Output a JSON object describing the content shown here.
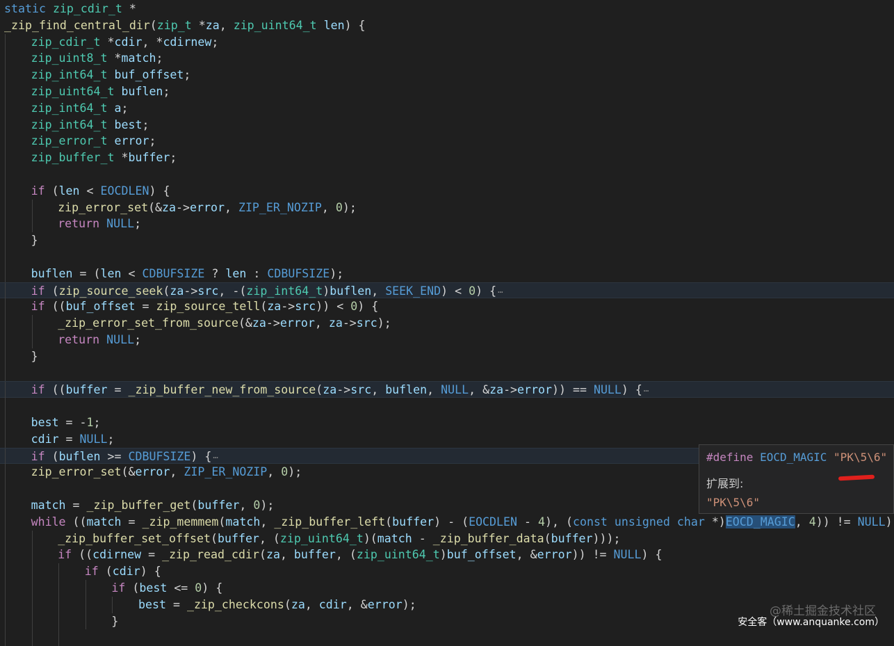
{
  "editor": {
    "language": "C",
    "lines": [
      {
        "indent": 0,
        "tokens": [
          [
            "kw",
            "static"
          ],
          [
            "op",
            " "
          ],
          [
            "ty",
            "zip_cdir_t"
          ],
          [
            "op",
            " *"
          ]
        ]
      },
      {
        "indent": 0,
        "tokens": [
          [
            "fn",
            "_zip_find_central_dir"
          ],
          [
            "op",
            "("
          ],
          [
            "ty",
            "zip_t"
          ],
          [
            "op",
            " *"
          ],
          [
            "var",
            "za"
          ],
          [
            "op",
            ", "
          ],
          [
            "ty",
            "zip_uint64_t"
          ],
          [
            "op",
            " "
          ],
          [
            "var",
            "len"
          ],
          [
            "op",
            ") {"
          ]
        ]
      },
      {
        "indent": 1,
        "tokens": [
          [
            "ty",
            "zip_cdir_t"
          ],
          [
            "op",
            " *"
          ],
          [
            "var",
            "cdir"
          ],
          [
            "op",
            ", *"
          ],
          [
            "var",
            "cdirnew"
          ],
          [
            "op",
            ";"
          ]
        ]
      },
      {
        "indent": 1,
        "tokens": [
          [
            "ty",
            "zip_uint8_t"
          ],
          [
            "op",
            " *"
          ],
          [
            "var",
            "match"
          ],
          [
            "op",
            ";"
          ]
        ]
      },
      {
        "indent": 1,
        "tokens": [
          [
            "ty",
            "zip_int64_t"
          ],
          [
            "op",
            " "
          ],
          [
            "var",
            "buf_offset"
          ],
          [
            "op",
            ";"
          ]
        ]
      },
      {
        "indent": 1,
        "tokens": [
          [
            "ty",
            "zip_uint64_t"
          ],
          [
            "op",
            " "
          ],
          [
            "var",
            "buflen"
          ],
          [
            "op",
            ";"
          ]
        ]
      },
      {
        "indent": 1,
        "tokens": [
          [
            "ty",
            "zip_int64_t"
          ],
          [
            "op",
            " "
          ],
          [
            "var",
            "a"
          ],
          [
            "op",
            ";"
          ]
        ]
      },
      {
        "indent": 1,
        "tokens": [
          [
            "ty",
            "zip_int64_t"
          ],
          [
            "op",
            " "
          ],
          [
            "var",
            "best"
          ],
          [
            "op",
            ";"
          ]
        ]
      },
      {
        "indent": 1,
        "tokens": [
          [
            "ty",
            "zip_error_t"
          ],
          [
            "op",
            " "
          ],
          [
            "var",
            "error"
          ],
          [
            "op",
            ";"
          ]
        ]
      },
      {
        "indent": 1,
        "tokens": [
          [
            "ty",
            "zip_buffer_t"
          ],
          [
            "op",
            " *"
          ],
          [
            "var",
            "buffer"
          ],
          [
            "op",
            ";"
          ]
        ]
      },
      {
        "indent": 1,
        "tokens": []
      },
      {
        "indent": 1,
        "tokens": [
          [
            "ctrl",
            "if"
          ],
          [
            "op",
            " ("
          ],
          [
            "var",
            "len"
          ],
          [
            "op",
            " < "
          ],
          [
            "mac",
            "EOCDLEN"
          ],
          [
            "op",
            ") {"
          ]
        ]
      },
      {
        "indent": 2,
        "tokens": [
          [
            "fn",
            "zip_error_set"
          ],
          [
            "op",
            "(&"
          ],
          [
            "var",
            "za"
          ],
          [
            "op",
            "->"
          ],
          [
            "var",
            "error"
          ],
          [
            "op",
            ", "
          ],
          [
            "mac",
            "ZIP_ER_NOZIP"
          ],
          [
            "op",
            ", "
          ],
          [
            "num",
            "0"
          ],
          [
            "op",
            ");"
          ]
        ]
      },
      {
        "indent": 2,
        "tokens": [
          [
            "ctrl",
            "return"
          ],
          [
            "op",
            " "
          ],
          [
            "mac",
            "NULL"
          ],
          [
            "op",
            ";"
          ]
        ]
      },
      {
        "indent": 1,
        "tokens": [
          [
            "op",
            "}"
          ]
        ]
      },
      {
        "indent": 1,
        "tokens": []
      },
      {
        "indent": 1,
        "tokens": [
          [
            "var",
            "buflen"
          ],
          [
            "op",
            " = ("
          ],
          [
            "var",
            "len"
          ],
          [
            "op",
            " < "
          ],
          [
            "mac",
            "CDBUFSIZE"
          ],
          [
            "op",
            " ? "
          ],
          [
            "var",
            "len"
          ],
          [
            "op",
            " : "
          ],
          [
            "mac",
            "CDBUFSIZE"
          ],
          [
            "op",
            ");"
          ]
        ]
      },
      {
        "indent": 1,
        "hl": true,
        "fold": true,
        "tokens": [
          [
            "ctrl",
            "if"
          ],
          [
            "op",
            " ("
          ],
          [
            "fn",
            "zip_source_seek"
          ],
          [
            "op",
            "("
          ],
          [
            "var",
            "za"
          ],
          [
            "op",
            "->"
          ],
          [
            "var",
            "src"
          ],
          [
            "op",
            ", -("
          ],
          [
            "ty",
            "zip_int64_t"
          ],
          [
            "op",
            ")"
          ],
          [
            "var",
            "buflen"
          ],
          [
            "op",
            ", "
          ],
          [
            "mac",
            "SEEK_END"
          ],
          [
            "op",
            ") < "
          ],
          [
            "num",
            "0"
          ],
          [
            "op",
            ") {"
          ]
        ]
      },
      {
        "indent": 1,
        "tokens": [
          [
            "ctrl",
            "if"
          ],
          [
            "op",
            " (("
          ],
          [
            "var",
            "buf_offset"
          ],
          [
            "op",
            " = "
          ],
          [
            "fn",
            "zip_source_tell"
          ],
          [
            "op",
            "("
          ],
          [
            "var",
            "za"
          ],
          [
            "op",
            "->"
          ],
          [
            "var",
            "src"
          ],
          [
            "op",
            ")) < "
          ],
          [
            "num",
            "0"
          ],
          [
            "op",
            ") {"
          ]
        ]
      },
      {
        "indent": 2,
        "tokens": [
          [
            "fn",
            "_zip_error_set_from_source"
          ],
          [
            "op",
            "(&"
          ],
          [
            "var",
            "za"
          ],
          [
            "op",
            "->"
          ],
          [
            "var",
            "error"
          ],
          [
            "op",
            ", "
          ],
          [
            "var",
            "za"
          ],
          [
            "op",
            "->"
          ],
          [
            "var",
            "src"
          ],
          [
            "op",
            ");"
          ]
        ]
      },
      {
        "indent": 2,
        "tokens": [
          [
            "ctrl",
            "return"
          ],
          [
            "op",
            " "
          ],
          [
            "mac",
            "NULL"
          ],
          [
            "op",
            ";"
          ]
        ]
      },
      {
        "indent": 1,
        "tokens": [
          [
            "op",
            "}"
          ]
        ]
      },
      {
        "indent": 1,
        "tokens": []
      },
      {
        "indent": 1,
        "hl": true,
        "fold": true,
        "tokens": [
          [
            "ctrl",
            "if"
          ],
          [
            "op",
            " (("
          ],
          [
            "var",
            "buffer"
          ],
          [
            "op",
            " = "
          ],
          [
            "fn",
            "_zip_buffer_new_from_source"
          ],
          [
            "op",
            "("
          ],
          [
            "var",
            "za"
          ],
          [
            "op",
            "->"
          ],
          [
            "var",
            "src"
          ],
          [
            "op",
            ", "
          ],
          [
            "var",
            "buflen"
          ],
          [
            "op",
            ", "
          ],
          [
            "mac",
            "NULL"
          ],
          [
            "op",
            ", &"
          ],
          [
            "var",
            "za"
          ],
          [
            "op",
            "->"
          ],
          [
            "var",
            "error"
          ],
          [
            "op",
            ")) == "
          ],
          [
            "mac",
            "NULL"
          ],
          [
            "op",
            ") {"
          ]
        ]
      },
      {
        "indent": 1,
        "tokens": []
      },
      {
        "indent": 1,
        "tokens": [
          [
            "var",
            "best"
          ],
          [
            "op",
            " = -"
          ],
          [
            "num",
            "1"
          ],
          [
            "op",
            ";"
          ]
        ]
      },
      {
        "indent": 1,
        "tokens": [
          [
            "var",
            "cdir"
          ],
          [
            "op",
            " = "
          ],
          [
            "mac",
            "NULL"
          ],
          [
            "op",
            ";"
          ]
        ]
      },
      {
        "indent": 1,
        "hl": true,
        "fold": true,
        "tokens": [
          [
            "ctrl",
            "if"
          ],
          [
            "op",
            " ("
          ],
          [
            "var",
            "buflen"
          ],
          [
            "op",
            " >= "
          ],
          [
            "mac",
            "CDBUFSIZE"
          ],
          [
            "op",
            ") {"
          ]
        ]
      },
      {
        "indent": 1,
        "tokens": [
          [
            "fn",
            "zip_error_set"
          ],
          [
            "op",
            "(&"
          ],
          [
            "var",
            "error"
          ],
          [
            "op",
            ", "
          ],
          [
            "mac",
            "ZIP_ER_NOZIP"
          ],
          [
            "op",
            ", "
          ],
          [
            "num",
            "0"
          ],
          [
            "op",
            ");"
          ]
        ]
      },
      {
        "indent": 1,
        "tokens": []
      },
      {
        "indent": 1,
        "tokens": [
          [
            "var",
            "match"
          ],
          [
            "op",
            " = "
          ],
          [
            "fn",
            "_zip_buffer_get"
          ],
          [
            "op",
            "("
          ],
          [
            "var",
            "buffer"
          ],
          [
            "op",
            ", "
          ],
          [
            "num",
            "0"
          ],
          [
            "op",
            ");"
          ]
        ]
      },
      {
        "indent": 1,
        "tokens": [
          [
            "ctrl",
            "while"
          ],
          [
            "op",
            " (("
          ],
          [
            "var",
            "match"
          ],
          [
            "op",
            " = "
          ],
          [
            "fn",
            "_zip_memmem"
          ],
          [
            "op",
            "("
          ],
          [
            "var",
            "match"
          ],
          [
            "op",
            ", "
          ],
          [
            "fn",
            "_zip_buffer_left"
          ],
          [
            "op",
            "("
          ],
          [
            "var",
            "buffer"
          ],
          [
            "op",
            ") - ("
          ],
          [
            "mac",
            "EOCDLEN"
          ],
          [
            "op",
            " - "
          ],
          [
            "num",
            "4"
          ],
          [
            "op",
            "), ("
          ],
          [
            "kw",
            "const"
          ],
          [
            "op",
            " "
          ],
          [
            "kw",
            "unsigned"
          ],
          [
            "op",
            " "
          ],
          [
            "kw",
            "char"
          ],
          [
            "op",
            " *)"
          ],
          [
            "hov",
            "EOCD_MAGIC"
          ],
          [
            "op",
            ", "
          ],
          [
            "num",
            "4"
          ],
          [
            "op",
            ")) != "
          ],
          [
            "mac",
            "NULL"
          ],
          [
            "op",
            ") {"
          ]
        ]
      },
      {
        "indent": 2,
        "tokens": [
          [
            "fn",
            "_zip_buffer_set_offset"
          ],
          [
            "op",
            "("
          ],
          [
            "var",
            "buffer"
          ],
          [
            "op",
            ", ("
          ],
          [
            "ty",
            "zip_uint64_t"
          ],
          [
            "op",
            ")("
          ],
          [
            "var",
            "match"
          ],
          [
            "op",
            " - "
          ],
          [
            "fn",
            "_zip_buffer_data"
          ],
          [
            "op",
            "("
          ],
          [
            "var",
            "buffer"
          ],
          [
            "op",
            ")));"
          ]
        ]
      },
      {
        "indent": 2,
        "tokens": [
          [
            "ctrl",
            "if"
          ],
          [
            "op",
            " (("
          ],
          [
            "var",
            "cdirnew"
          ],
          [
            "op",
            " = "
          ],
          [
            "fn",
            "_zip_read_cdir"
          ],
          [
            "op",
            "("
          ],
          [
            "var",
            "za"
          ],
          [
            "op",
            ", "
          ],
          [
            "var",
            "buffer"
          ],
          [
            "op",
            ", ("
          ],
          [
            "ty",
            "zip_uint64_t"
          ],
          [
            "op",
            ")"
          ],
          [
            "var",
            "buf_offset"
          ],
          [
            "op",
            ", &"
          ],
          [
            "var",
            "error"
          ],
          [
            "op",
            ")) != "
          ],
          [
            "mac",
            "NULL"
          ],
          [
            "op",
            ") {"
          ]
        ]
      },
      {
        "indent": 3,
        "tokens": [
          [
            "ctrl",
            "if"
          ],
          [
            "op",
            " ("
          ],
          [
            "var",
            "cdir"
          ],
          [
            "op",
            ") {"
          ]
        ]
      },
      {
        "indent": 4,
        "tokens": [
          [
            "ctrl",
            "if"
          ],
          [
            "op",
            " ("
          ],
          [
            "var",
            "best"
          ],
          [
            "op",
            " <= "
          ],
          [
            "num",
            "0"
          ],
          [
            "op",
            ") {"
          ]
        ]
      },
      {
        "indent": 5,
        "tokens": [
          [
            "var",
            "best"
          ],
          [
            "op",
            " = "
          ],
          [
            "fn",
            "_zip_checkcons"
          ],
          [
            "op",
            "("
          ],
          [
            "var",
            "za"
          ],
          [
            "op",
            ", "
          ],
          [
            "var",
            "cdir"
          ],
          [
            "op",
            ", &"
          ],
          [
            "var",
            "error"
          ],
          [
            "op",
            ");"
          ]
        ]
      },
      {
        "indent": 4,
        "tokens": [
          [
            "op",
            "}"
          ]
        ]
      },
      {
        "indent": 3,
        "tokens": []
      }
    ],
    "fold_marker": "⋯"
  },
  "hover": {
    "define_keyword": "#define",
    "macro_name": "EOCD_MAGIC",
    "macro_value": "\"PK\\5\\6\"",
    "expands_label": "扩展到:",
    "expanded_value": "\"PK\\5\\6\""
  },
  "watermarks": {
    "juejin": "@稀土掘金技术社区",
    "anquanke": "安全客（www.anquanke.com）"
  }
}
